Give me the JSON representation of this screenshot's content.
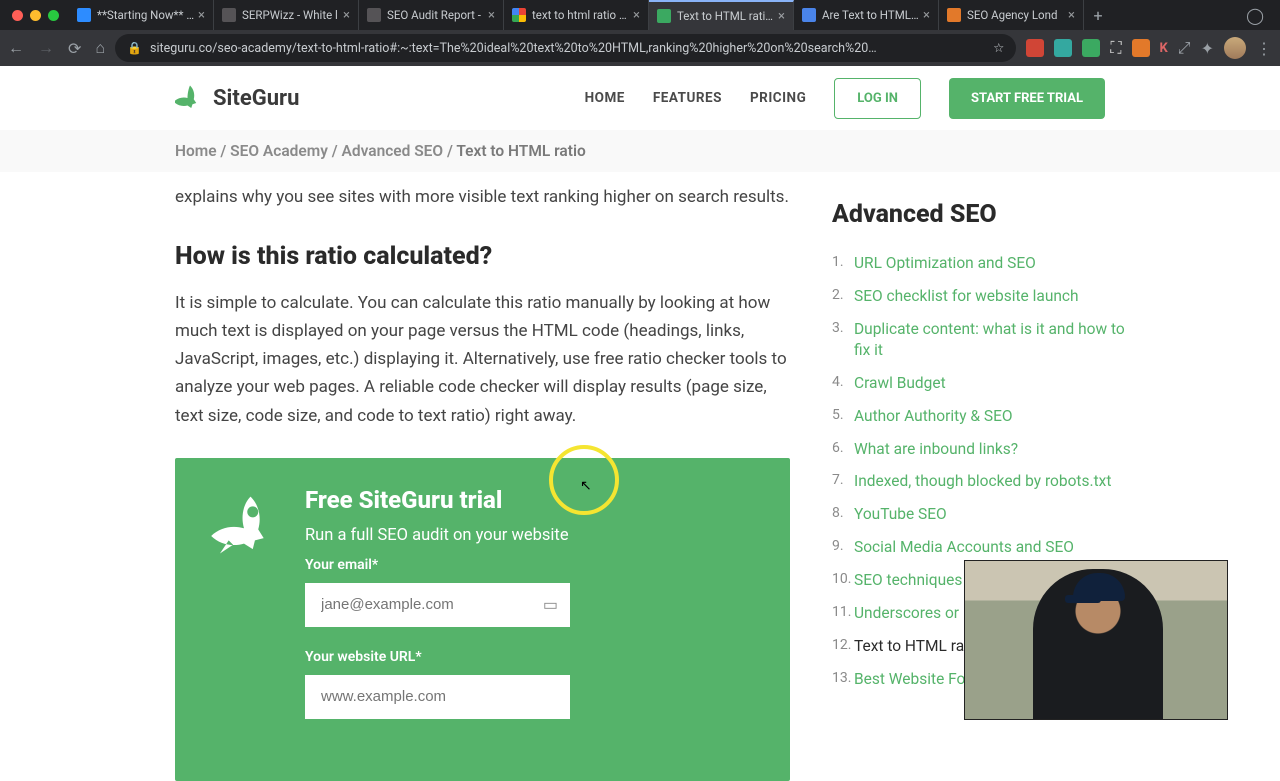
{
  "browser": {
    "tabs": [
      {
        "title": "**Starting Now** H"
      },
      {
        "title": "SERPWizz - White l"
      },
      {
        "title": "SEO Audit Report -"
      },
      {
        "title": "text to html ratio se"
      },
      {
        "title": "Text to HTML ratio:"
      },
      {
        "title": "Are Text to HTML R"
      },
      {
        "title": "SEO Agency Lond"
      }
    ],
    "url": "siteguru.co/seo-academy/text-to-html-ratio#:~:text=The%20ideal%20text%20to%20HTML,ranking%20higher%20on%20search%20…"
  },
  "logo": "SiteGuru",
  "nav": {
    "home": "HOME",
    "features": "FEATURES",
    "pricing": "PRICING",
    "login": "LOG IN",
    "trial": "START FREE TRIAL"
  },
  "breadcrumb": {
    "home": "Home",
    "academy": "SEO Academy",
    "advanced": "Advanced SEO",
    "current": "Text to HTML ratio"
  },
  "article": {
    "lead": "explains why you see sites with more visible text ranking higher on search results.",
    "h2": "How is this ratio calculated?",
    "body": "It is simple to calculate. You can calculate this ratio manually by looking at how much text is displayed on your page versus the HTML code (headings, links, JavaScript, images, etc.) displaying it. Alternatively, use free ratio checker tools to analyze your web pages. A reliable code checker will display results (page size, text size, code size, and code to text ratio) right away."
  },
  "cta": {
    "title": "Free SiteGuru trial",
    "subtitle": "Run a full SEO audit on your website",
    "email_label": "Your email*",
    "email_placeholder": "jane@example.com",
    "url_label": "Your website URL*",
    "url_placeholder": "www.example.com"
  },
  "sidebar": {
    "title": "Advanced SEO",
    "items": [
      "URL Optimization and SEO",
      "SEO checklist for website launch",
      "Duplicate content: what is it and how to fix it",
      "Crawl Budget",
      "Author Authority & SEO",
      "What are inbound links?",
      "Indexed, though blocked by robots.txt",
      "YouTube SEO",
      "Social Media Accounts and SEO",
      "SEO techniques to avoid",
      "Underscores or Hyphens for SEO URLs?",
      "Text to HTML ratio",
      "Best Website Fon"
    ]
  }
}
